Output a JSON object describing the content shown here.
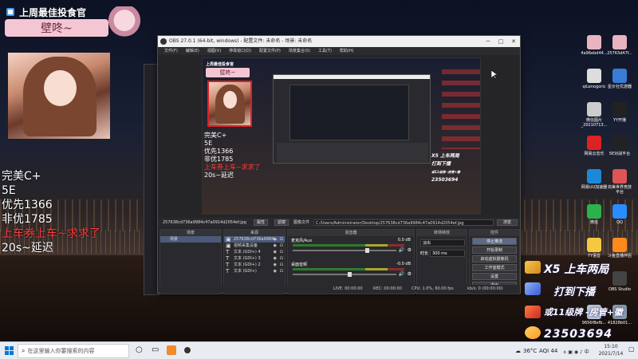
{
  "overlay": {
    "title": "上周最佳投食官",
    "name": "壁咚~",
    "lines": [
      {
        "text": "完美C+",
        "color": "#ffffff"
      },
      {
        "text": "5E",
        "color": "#ffffff"
      },
      {
        "text": "优先1366",
        "color": "#ffffff"
      },
      {
        "text": "非优1785",
        "color": "#ffffff"
      },
      {
        "text": "上车券上车~求求了",
        "color": "#ff3a3a"
      },
      {
        "text": "20s~延迟",
        "color": "#ffffff"
      }
    ]
  },
  "stream_panel": {
    "line1": "X5 上车两局",
    "line2": "打到下播",
    "line3": "或11级牌 -房管+徽",
    "number": "23503694"
  },
  "desktop_icons": [
    {
      "label": "4a96ebd44..."
    },
    {
      "label": "25763d47f..."
    },
    {
      "label": "qiLenogoric"
    },
    {
      "label": "星价社优游器"
    },
    {
      "label": "微信图片_20210713..."
    },
    {
      "label": "YY开播"
    },
    {
      "label": "网易云音乐"
    },
    {
      "label": "5E对战平台"
    },
    {
      "label": "网易UU加速器"
    },
    {
      "label": "完美世界竞技平台"
    },
    {
      "label": "微信"
    },
    {
      "label": "QQ"
    },
    {
      "label": "YY语音"
    },
    {
      "label": "斗鱼直播伴侣"
    },
    {
      "label": "OBS Studio"
    },
    {
      "label": "9656f8efb..."
    },
    {
      "label": "41828b01..."
    }
  ],
  "obs": {
    "title": "OBS 27.0.1 (64-bit, windows) - 配置文件: 未命名 - 场景: 未命名",
    "menu": [
      "文件(F)",
      "编辑(E)",
      "视图(V)",
      "停靠窗口(D)",
      "配置文件(P)",
      "场景集合(S)",
      "工具(T)",
      "帮助(H)"
    ],
    "source_file": "257638cd736a9984c47a0914d2054ef.jpg",
    "properties": "属性",
    "filters": "滤镜",
    "image_file_label": "图像文件",
    "image_path": "C:/Users/Administrator/Desktop/257638cd736a9984c47a0914d2054ef.jpg",
    "browse": "浏览",
    "docks": {
      "scenes": "场景",
      "sources": "来源",
      "mixer": "混音器",
      "transitions": "转场特效",
      "controls": "控件"
    },
    "scenes": [
      "场景"
    ],
    "sources": [
      "257638cd736a9984...",
      "视频采集设备",
      "文本 (GDI+) 4",
      "文本 (GDI+) 3",
      "文本 (GDI+) 2",
      "文本 (GDI+)"
    ],
    "mixer": [
      {
        "name": "麦克风/Aux",
        "db": "0.0 dB",
        "level": 0.72
      },
      {
        "name": "桌面音频",
        "db": "-0.0 dB",
        "level": 0.55
      }
    ],
    "transition": "淡出",
    "duration_label": "时长",
    "duration": "300 ms",
    "controls": [
      "停止推流",
      "开始录制",
      "启动虚拟摄像机",
      "工作室模式",
      "设置",
      "退出"
    ],
    "status": {
      "live": "LIVE: 00:00:00",
      "rec": "REC: 00:00:00",
      "cpu": "CPU: 1.0%, 60.00 fps",
      "kb": "kb/s: 0 (00:00:00)"
    },
    "preview_text": [
      "完美C+",
      "5E",
      "优先1366",
      "非优1785",
      "上车券上车~求求了",
      "20s~延迟"
    ]
  },
  "taskbar": {
    "search_placeholder": "在这里输入你要搜索的内容",
    "weather": "36°C",
    "aqi": "AQI 44",
    "time": "15:10",
    "date": "2021/7/14"
  },
  "colors": {
    "obs_bg": "#252528",
    "accent_pink": "#f4c6d3",
    "red_text": "#ff3a3a"
  }
}
